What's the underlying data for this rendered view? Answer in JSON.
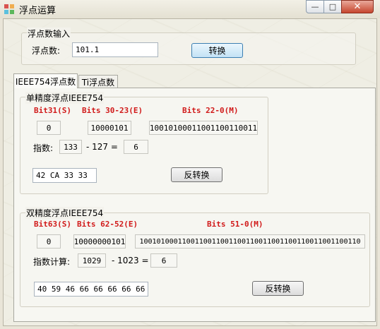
{
  "window": {
    "title": "浮点运算",
    "minimize": "—",
    "maximize": "□",
    "close": "✕"
  },
  "input_group": {
    "legend": "浮点数输入",
    "label": "浮点数:",
    "value": "101.1",
    "convert_button": "转换"
  },
  "tabs": [
    {
      "label": "IEEE754浮点数"
    },
    {
      "label": "Ti浮点数"
    }
  ],
  "single": {
    "legend": "单精度浮点IEEE754",
    "headers": {
      "sign": "Bit31(S)",
      "exponent": "Bits 30-23(E)",
      "mantissa": "Bits 22-0(M)"
    },
    "sign": "0",
    "exponent_bits": "10000101",
    "mantissa_bits": "10010100011001100110011",
    "exp_label": "指数:",
    "exp_value": "133",
    "minus_bias": "- 127 =",
    "exp_result": "6",
    "hex": "42 CA 33 33",
    "reverse_button": "反转换"
  },
  "double": {
    "legend": "双精度浮点IEEE754",
    "headers": {
      "sign": "Bit63(S)",
      "exponent": "Bits 62-52(E)",
      "mantissa": "Bits 51-0(M)"
    },
    "sign": "0",
    "exponent_bits": "10000000101",
    "mantissa_bits": "1001010001100110011001100110011001100110011001100110",
    "exp_label": "指数计算:",
    "exp_value": "1029",
    "minus_bias": "- 1023 =",
    "exp_result": "6",
    "hex": "40 59 46 66 66 66 66 66",
    "reverse_button": "反转换"
  }
}
